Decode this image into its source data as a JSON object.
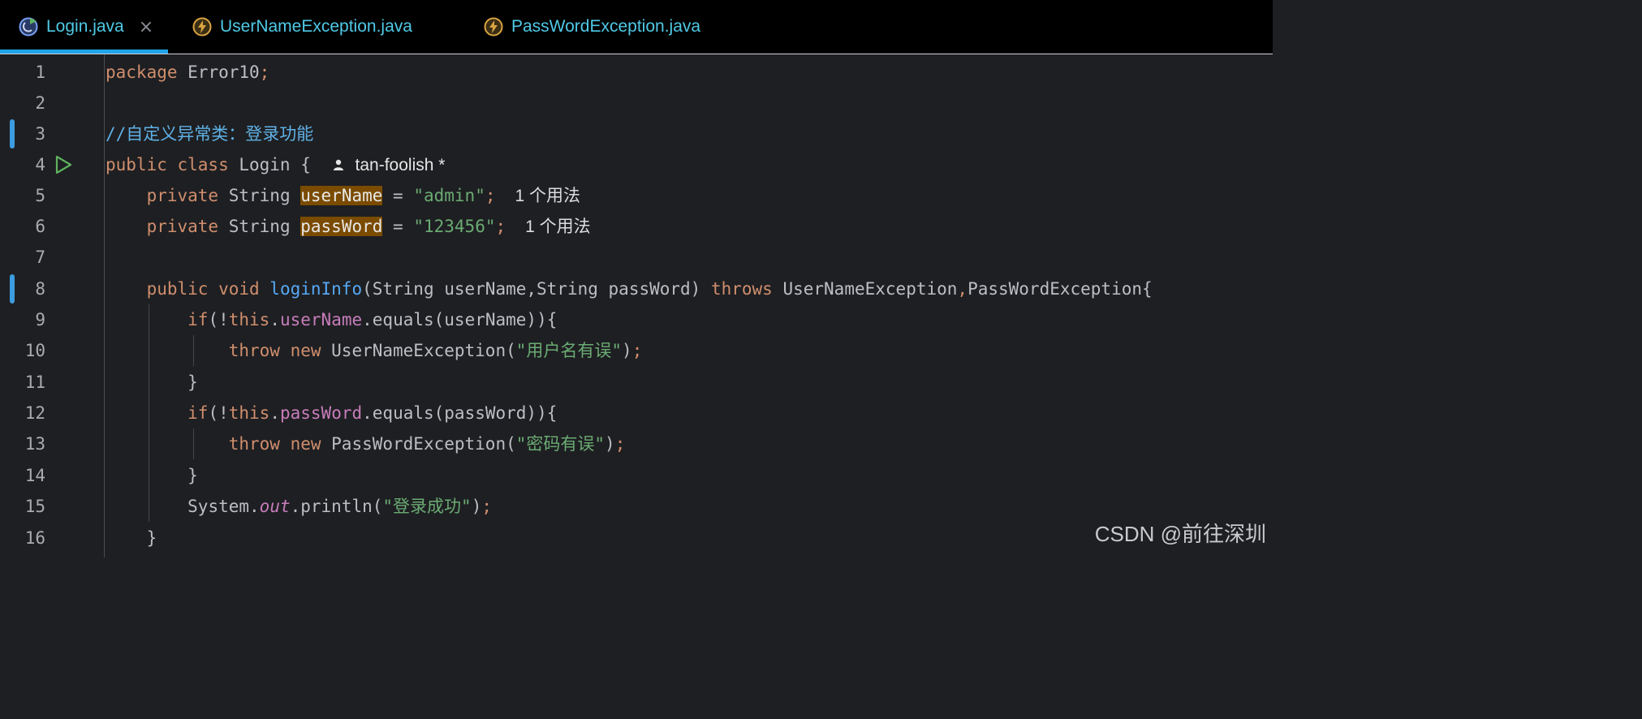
{
  "tabs": [
    {
      "label": "Login.java",
      "icon": "java-class-run-icon",
      "active": true,
      "closable": true
    },
    {
      "label": "UserNameException.java",
      "icon": "exception-class-icon",
      "active": false
    },
    {
      "label": "PassWordException.java",
      "icon": "exception-class-icon",
      "active": false
    }
  ],
  "gutter": {
    "line_numbers": [
      "1",
      "2",
      "3",
      "4",
      "5",
      "6",
      "7",
      "8",
      "9",
      "10",
      "11",
      "12",
      "13",
      "14",
      "15",
      "16"
    ]
  },
  "code": {
    "l1": {
      "kw": "package",
      "rest": " Error10",
      "semi": ";"
    },
    "l3": {
      "slashes": "//",
      "comment": "自定义异常类：登录功能"
    },
    "l4": {
      "kw": "public class",
      "rest": " Login {",
      "author": "tan-foolish *"
    },
    "l5": {
      "indent": "    ",
      "kw": "private",
      "type": " String ",
      "field": "userName",
      "eq": " = ",
      "str": "\"admin\"",
      "semi": ";",
      "hint": "1 个用法"
    },
    "l6": {
      "indent": "    ",
      "kw": "private",
      "type": " String ",
      "field": "passWord",
      "eq": " = ",
      "str": "\"123456\"",
      "semi": ";",
      "hint": "1 个用法"
    },
    "l8": {
      "indent": "    ",
      "kw": "public void",
      "fn": " loginInfo",
      "params": "(String userName,String passWord) ",
      "throws": "throws",
      "ex1": " UserNameException",
      "comma": ",",
      "ex2": "PassWordException{"
    },
    "l9": {
      "indent": "        ",
      "kw": "if",
      "pre": "(!",
      "this": "this",
      "dot": ".",
      "field": "userName",
      "post": ".equals(userName)){"
    },
    "l10": {
      "indent": "            ",
      "kw": "throw new",
      "cls": " UserNameException(",
      "str": "\"用户名有误\"",
      "close": ")",
      "semi": ";"
    },
    "l11": {
      "text": "        }"
    },
    "l12": {
      "indent": "        ",
      "kw": "if",
      "pre": "(!",
      "this": "this",
      "dot": ".",
      "field": "passWord",
      "post": ".equals(passWord)){"
    },
    "l13": {
      "indent": "            ",
      "kw": "throw new",
      "cls": " PassWordException(",
      "str": "\"密码有误\"",
      "close": ")",
      "semi": ";"
    },
    "l14": {
      "text": "        }"
    },
    "l15": {
      "indent": "        ",
      "sys": "System.",
      "out": "out",
      "call": ".println(",
      "str": "\"登录成功\"",
      "close": ")",
      "semi": ";"
    },
    "l16": {
      "text": "    }"
    }
  },
  "watermark": "CSDN @前往深圳",
  "colors": {
    "keyword": "#cf8e6d",
    "string": "#6aab73",
    "function": "#56a8f5",
    "field": "#c77dbb",
    "tab_text": "#4fc9e6",
    "accent": "#21a5e8",
    "highlight": "#7a4b00"
  }
}
